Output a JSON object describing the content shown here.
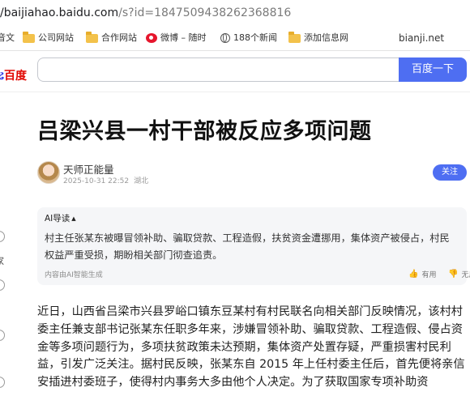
{
  "browser": {
    "url_host": "/baijiahao.baidu.com",
    "url_path": "/s?id=1847509438262368816"
  },
  "bookmarks": {
    "partial_left": "音文",
    "items": [
      {
        "label": "公司网站",
        "icon": "folder-icon"
      },
      {
        "label": "合作网站",
        "icon": "folder-icon"
      },
      {
        "label": "微博 – 随时",
        "icon": "weibo-icon"
      },
      {
        "label": "188个新闻",
        "icon": "globe-icon"
      },
      {
        "label": "添加信息网",
        "icon": "folder-icon"
      }
    ],
    "right_link": "bianji.net"
  },
  "search": {
    "logo_text": "百度",
    "input_value": "",
    "button_label": "百度一下"
  },
  "left_strip": {
    "label": "家"
  },
  "article": {
    "title": "吕梁兴县一村干部被反应多项问题",
    "author": "天师正能量",
    "date": "2025-10-31 22:52",
    "location": "湖北",
    "follow_label": "关注",
    "ai": {
      "title": "AI导读",
      "caret": "▲",
      "summary": "村主任张某东被曝冒领补助、骗取贷款、工程造假，扶贫资金遭挪用，集体资产被侵占，村民权益严重受损，期盼相关部门彻查追责。",
      "note": "内容由AI智能生成",
      "useful": "有用",
      "useless": "无用"
    },
    "body": "近日，山西省吕梁市兴县罗峪口镇东豆某村有村民联名向相关部门反映情况，该村村委主任兼支部书记张某东任职多年来，涉嫌冒领补助、骗取贷款、工程造假、侵占资金等多项问题行为，多项扶贫政策未达预期，集体资产处置存疑，严重损害村民利益，引发广泛关注。据村民反映，张某东自 2015 年上任村委主任后，首先便将亲信安插进村委班子，使得村内事务大多由他个人决定。为了获取国家专项补助资"
  },
  "colors": {
    "accent": "#4e6ef2",
    "baidu_red": "#e10601",
    "baidu_blue": "#2932e1",
    "ai_box_bg": "#f5f6f8"
  }
}
